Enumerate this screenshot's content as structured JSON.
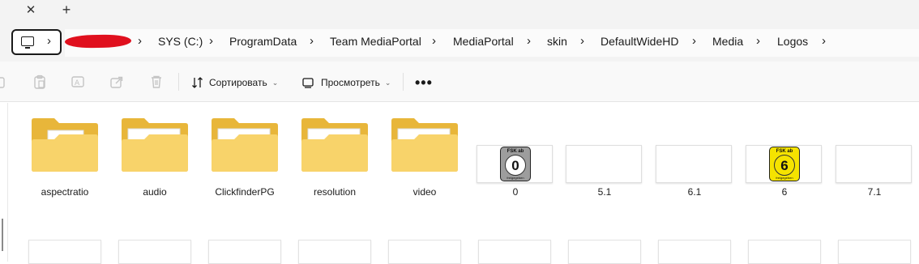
{
  "tabs": {
    "close_glyph": "✕",
    "add_glyph": "+"
  },
  "address_bar": {
    "root_icon": "monitor-icon",
    "redacted_segment": "redacted",
    "breadcrumbs": [
      "SYS (C:)",
      "ProgramData",
      "Team MediaPortal",
      "MediaPortal",
      "skin",
      "DefaultWideHD",
      "Media",
      "Logos"
    ],
    "separator": "›"
  },
  "toolbar": {
    "sort_label": "Сортировать",
    "view_label": "Просмотреть",
    "more_glyph": "•••",
    "disabled_icons": [
      "copy-icon",
      "paste-icon",
      "rename-icon",
      "share-icon",
      "delete-icon"
    ],
    "disabled_color": "#c4c4c4"
  },
  "items": {
    "folders": [
      {
        "name": "aspectratio",
        "icon": "folder-icon"
      },
      {
        "name": "audio",
        "icon": "folder-icon"
      },
      {
        "name": "ClickfinderPG",
        "icon": "folder-icon"
      },
      {
        "name": "resolution",
        "icon": "folder-icon"
      },
      {
        "name": "video",
        "icon": "folder-icon"
      }
    ],
    "images": [
      {
        "name": "0",
        "thumb": "fsk-0-badge",
        "badge_top": "FSK ab",
        "badge_num": "0",
        "badge_bottom": "freigegeben",
        "color": "#9d9d9d"
      },
      {
        "name": "5.1",
        "thumb": "blank"
      },
      {
        "name": "6.1",
        "thumb": "blank"
      },
      {
        "name": "6",
        "thumb": "fsk-6-badge",
        "badge_top": "FSK ab",
        "badge_num": "6",
        "badge_bottom": "freigegeben",
        "color": "#f5e300"
      },
      {
        "name": "7.1",
        "thumb": "blank"
      }
    ]
  },
  "colors": {
    "folder_back": "#e8b63a",
    "folder_front": "#f8d36a",
    "redaction": "#e0101e"
  }
}
